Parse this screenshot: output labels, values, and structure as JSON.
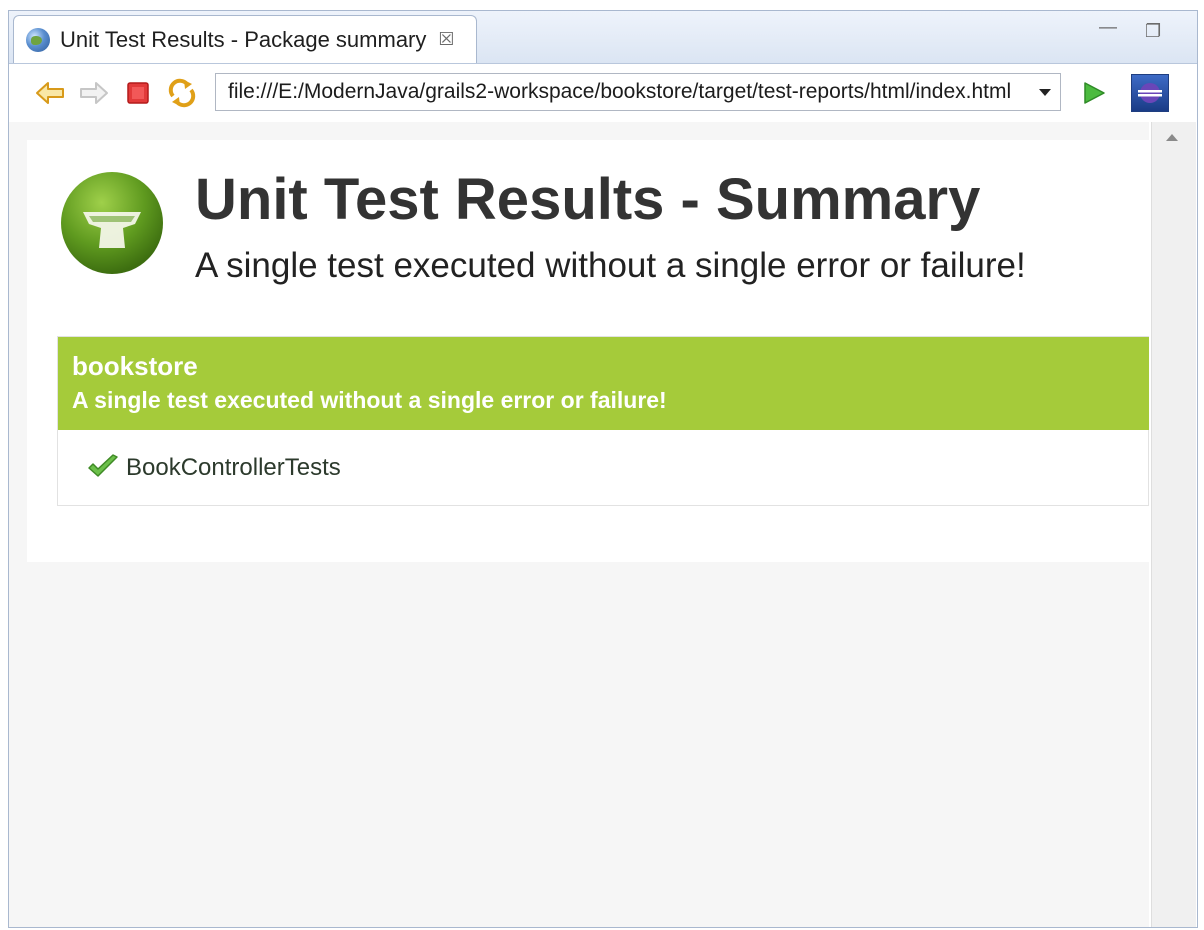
{
  "browser": {
    "tab_title": "Unit Test Results - Package summary",
    "url": "file:///E:/ModernJava/grails2-workspace/bookstore/target/test-reports/html/index.html",
    "icons": {
      "tab": "globe-icon",
      "tab_close": "close-icon",
      "back": "back-arrow-icon",
      "forward": "forward-arrow-icon",
      "stop": "stop-icon",
      "refresh": "refresh-icon",
      "dropdown": "chevron-down-icon",
      "go": "play-icon",
      "extension": "eclipse-icon"
    }
  },
  "page": {
    "title": "Unit Test Results - Summary",
    "subtitle": "A single test executed without a single error or failure!",
    "logo": "grails-cup-logo",
    "package": {
      "name": "bookstore",
      "summary": "A single test executed without a single error or failure!",
      "tests": [
        {
          "name": "BookControllerTests",
          "status": "passed"
        }
      ]
    }
  },
  "colors": {
    "accent_green": "#a5cb3a",
    "title_text": "#333333",
    "chrome_blue": "#dbe5f3"
  }
}
